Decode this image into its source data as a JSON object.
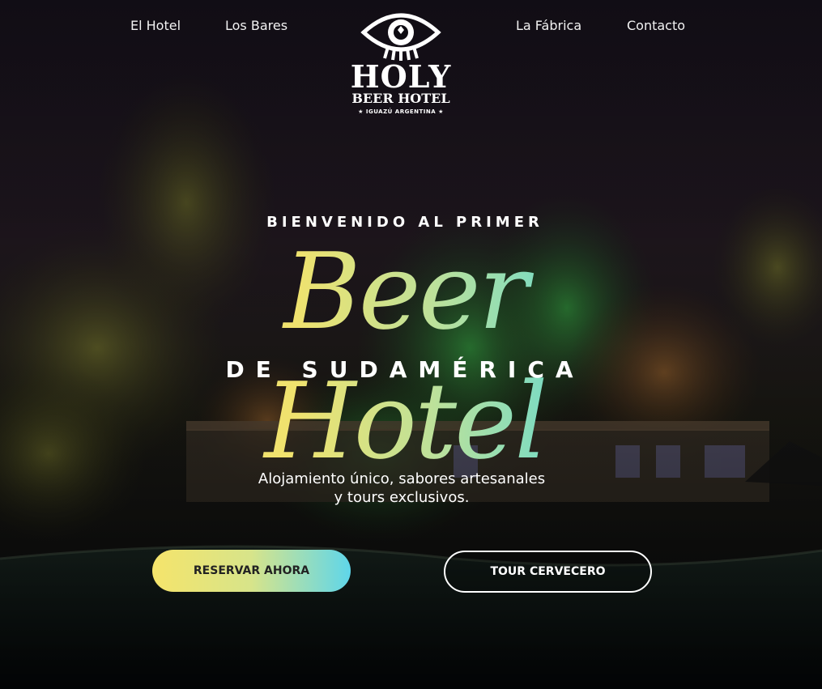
{
  "nav": {
    "left": [
      "El Hotel",
      "Los Bares"
    ],
    "right": [
      "La Fábrica",
      "Contacto"
    ]
  },
  "logo": {
    "icon": "eye-hop-icon",
    "line1": "HOLY",
    "line2": "BEER HOTEL",
    "line3": "★ IGUAZÚ ARGENTINA ★"
  },
  "hero": {
    "eyebrow": "BIENVENIDO AL PRIMER",
    "headline": "Beer Hotel",
    "subhead": "DE SUDAMÉRICA",
    "tagline_line1": "Alojamiento único, sabores artesanales",
    "tagline_line2": "y tours exclusivos."
  },
  "buttons": {
    "primary": "RESERVAR AHORA",
    "secondary": "TOUR CERVECERO"
  },
  "colors": {
    "gradient_start": "#f7e46a",
    "gradient_mid": "#bde19a",
    "gradient_end": "#4dd2ee"
  }
}
